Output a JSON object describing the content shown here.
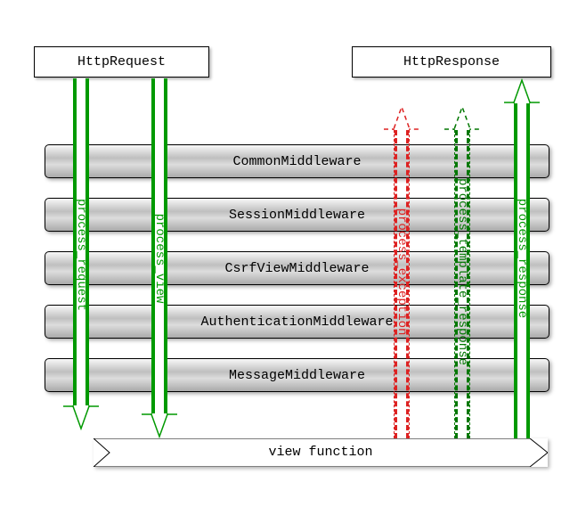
{
  "top": {
    "request_label": "HttpRequest",
    "response_label": "HttpResponse"
  },
  "middlewares": [
    "CommonMiddleware",
    "SessionMiddleware",
    "CsrfViewMiddleware",
    "AuthenticationMiddleware",
    "MessageMiddleware"
  ],
  "bottom": {
    "label": "view function"
  },
  "arrows": {
    "process_request": "process_request",
    "process_view": "process_view",
    "process_exception": "process_exception",
    "process_template_response": "process_template_response",
    "process_response": "process_response"
  }
}
